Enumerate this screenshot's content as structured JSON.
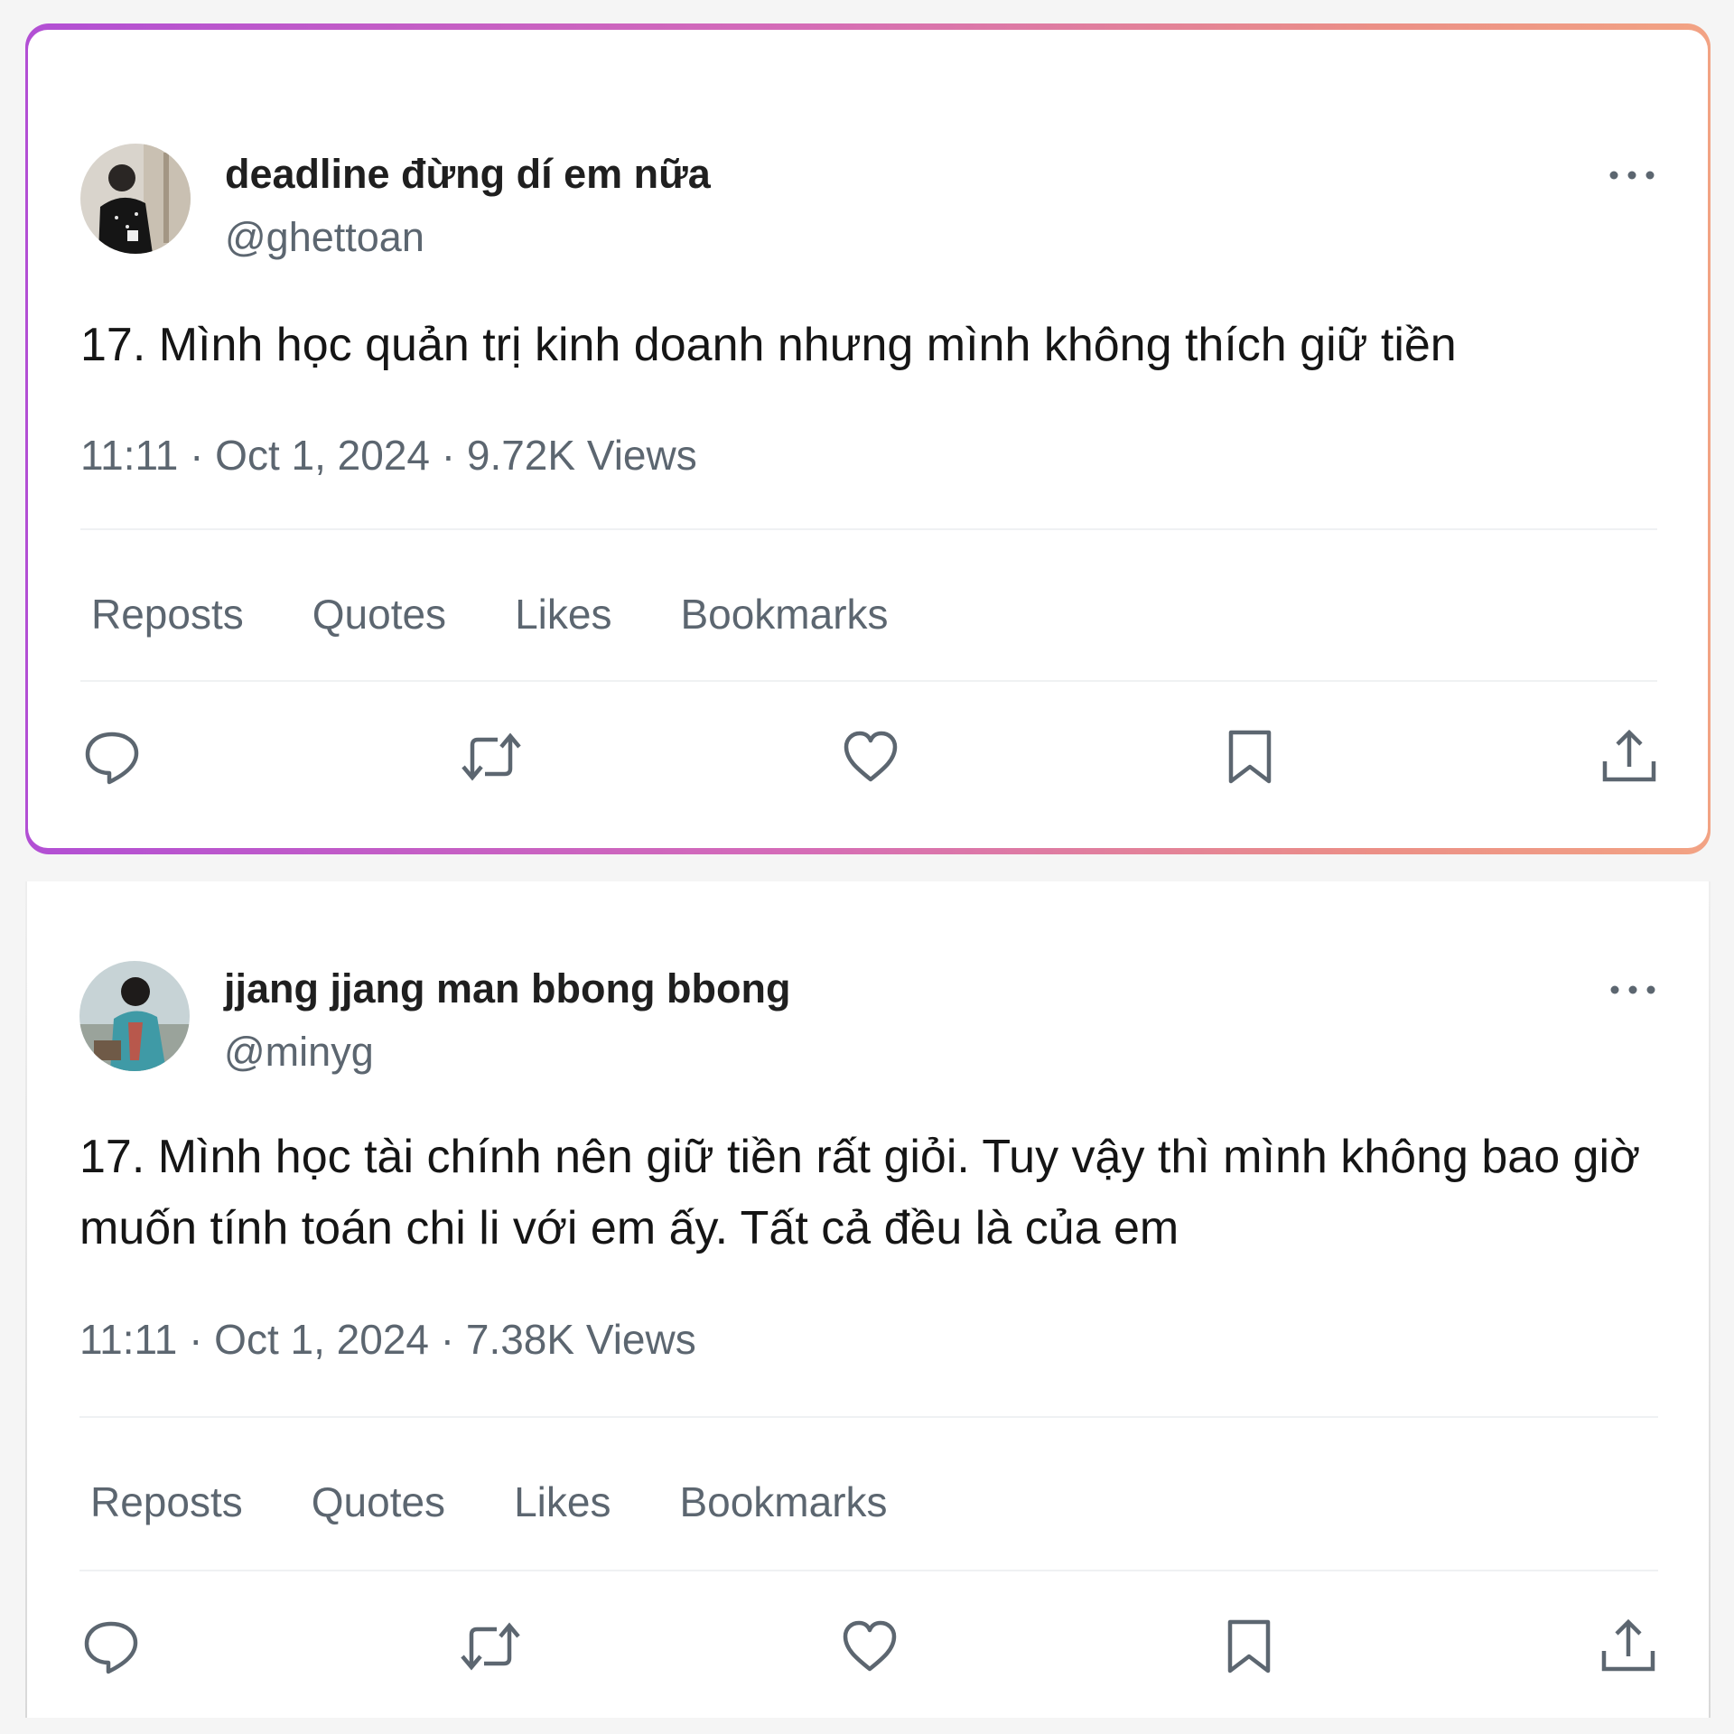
{
  "tweets": [
    {
      "display_name": "deadline đừng dí em nữa",
      "handle": "@ghettoan",
      "text": "17. Mình học quản trị kinh doanh nhưng mình không thích giữ tiền",
      "meta": "11:11 · Oct 1, 2024 · 9.72K Views",
      "stats": {
        "reposts": "Reposts",
        "quotes": "Quotes",
        "likes": "Likes",
        "bookmarks": "Bookmarks"
      },
      "avatar_icon": "profile-photo"
    },
    {
      "display_name": "jjang jjang man bbong bbong",
      "handle": "@minyg",
      "text": "17. Mình học tài chính nên giữ tiền rất giỏi. Tuy vậy thì mình không bao giờ muốn tính toán chi li với em ấy. Tất cả đều là của em",
      "meta": "11:11 · Oct 1, 2024 · 7.38K Views",
      "stats": {
        "reposts": "Reposts",
        "quotes": "Quotes",
        "likes": "Likes",
        "bookmarks": "Bookmarks"
      },
      "avatar_icon": "profile-photo"
    }
  ],
  "icons": [
    "more-icon",
    "reply-icon",
    "repost-icon",
    "like-icon",
    "bookmark-icon",
    "share-icon"
  ],
  "colors": {
    "frame_gradient_start": "#b24fd4",
    "frame_gradient_end": "#f2a384",
    "text_primary": "#151515",
    "text_secondary": "#5c6670",
    "icon": "#5c6670"
  }
}
